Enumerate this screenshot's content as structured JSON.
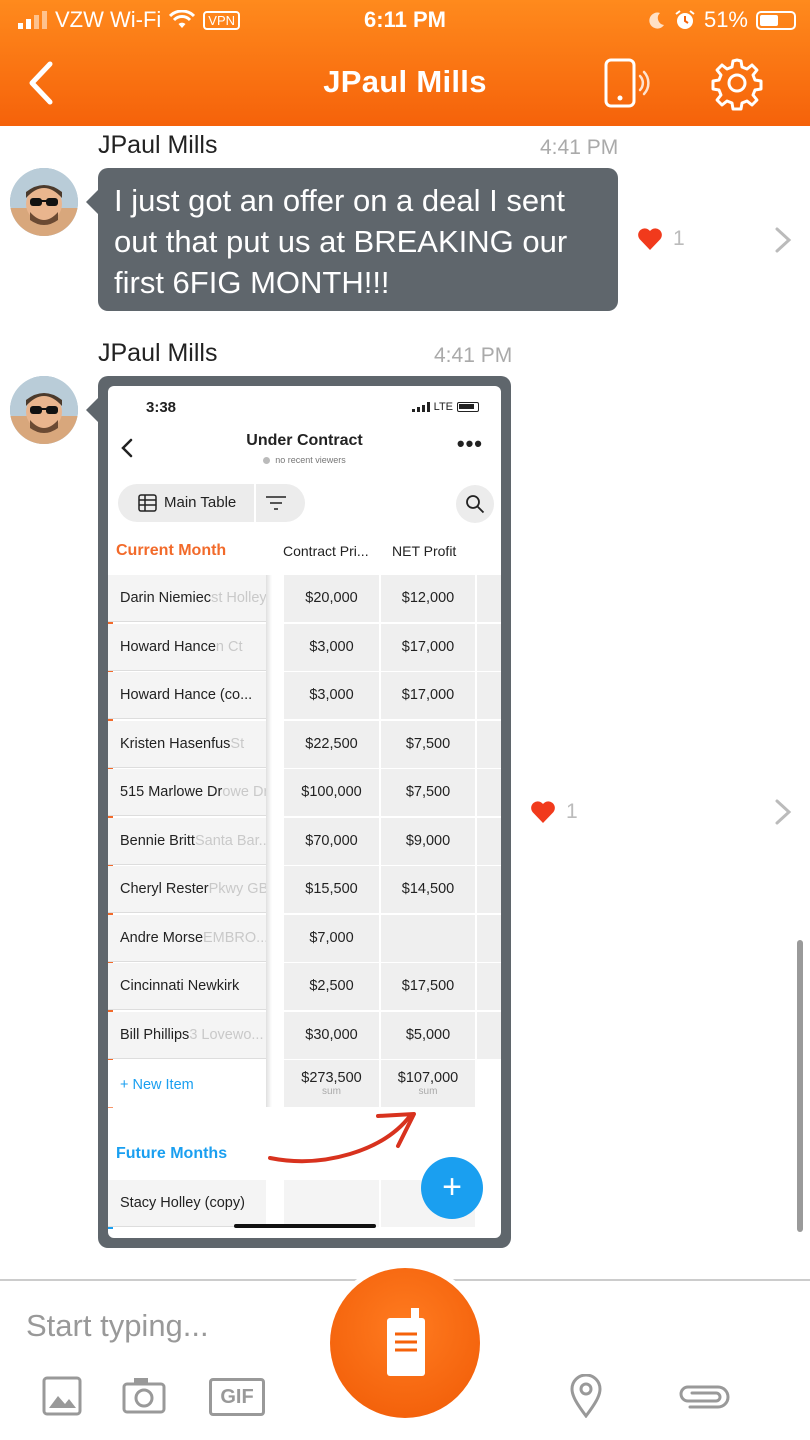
{
  "status_bar": {
    "carrier": "VZW Wi-Fi",
    "vpn": "VPN",
    "time": "6:11 PM",
    "battery": "51%"
  },
  "header": {
    "title": "JPaul Mills"
  },
  "messages": [
    {
      "sender": "JPaul Mills",
      "time": "4:41 PM",
      "text": "I just got an offer on a deal I sent out that put us at BREAKING our first 6FIG MONTH!!!",
      "likes": "1"
    },
    {
      "sender": "JPaul Mills",
      "time": "4:41 PM",
      "likes": "1"
    }
  ],
  "embedded": {
    "status_time": "3:38",
    "network": "LTE",
    "board_title": "Under Contract",
    "viewers": "no recent viewers",
    "view_label": "Main Table",
    "group_current": "Current Month",
    "columns": [
      "Contract Pri...",
      "NET Profit"
    ],
    "rows": [
      {
        "name": "Darin Niemiec",
        "ghost": "st Holley",
        "contract": "$20,000",
        "profit": "$12,000"
      },
      {
        "name": "Howard Hance",
        "ghost": "n Ct",
        "contract": "$3,000",
        "profit": "$17,000"
      },
      {
        "name": "Howard Hance (co...",
        "ghost": "",
        "contract": "$3,000",
        "profit": "$17,000"
      },
      {
        "name": "Kristen  Hasenfus",
        "ghost": "St",
        "contract": "$22,500",
        "profit": "$7,500"
      },
      {
        "name": "515 Marlowe Dr",
        "ghost": "owe Dr",
        "contract": "$100,000",
        "profit": "$7,500"
      },
      {
        "name": "Bennie Britt",
        "ghost": "Santa Bar...",
        "contract": "$70,000",
        "profit": "$9,000"
      },
      {
        "name": "Cheryl Rester",
        "ghost": "Pkwy GB",
        "contract": "$15,500",
        "profit": "$14,500"
      },
      {
        "name": "Andre Morse",
        "ghost": "EMBRO...",
        "contract": "$7,000",
        "profit": ""
      },
      {
        "name": "Cincinnati Newkirk",
        "ghost": "",
        "contract": "$2,500",
        "profit": "$17,500"
      },
      {
        "name": "Bill Phillips",
        "ghost": "3 Lovewo...",
        "contract": "$30,000",
        "profit": "$5,000"
      }
    ],
    "new_item": "+ New Item",
    "sum_contract": "$273,500",
    "sum_profit": "$107,000",
    "sum_label": "sum",
    "group_future": "Future Months",
    "future_rows": [
      {
        "name": "Stacy Holley (copy)"
      }
    ],
    "colors": {
      "current": "#f26a2a",
      "future": "#1a9ff0"
    }
  },
  "composer": {
    "placeholder": "Start typing...",
    "gif_label": "GIF"
  },
  "colors": {
    "brand": "#f5620a",
    "bubble": "#5f666c",
    "heart": "#f13a1c"
  }
}
